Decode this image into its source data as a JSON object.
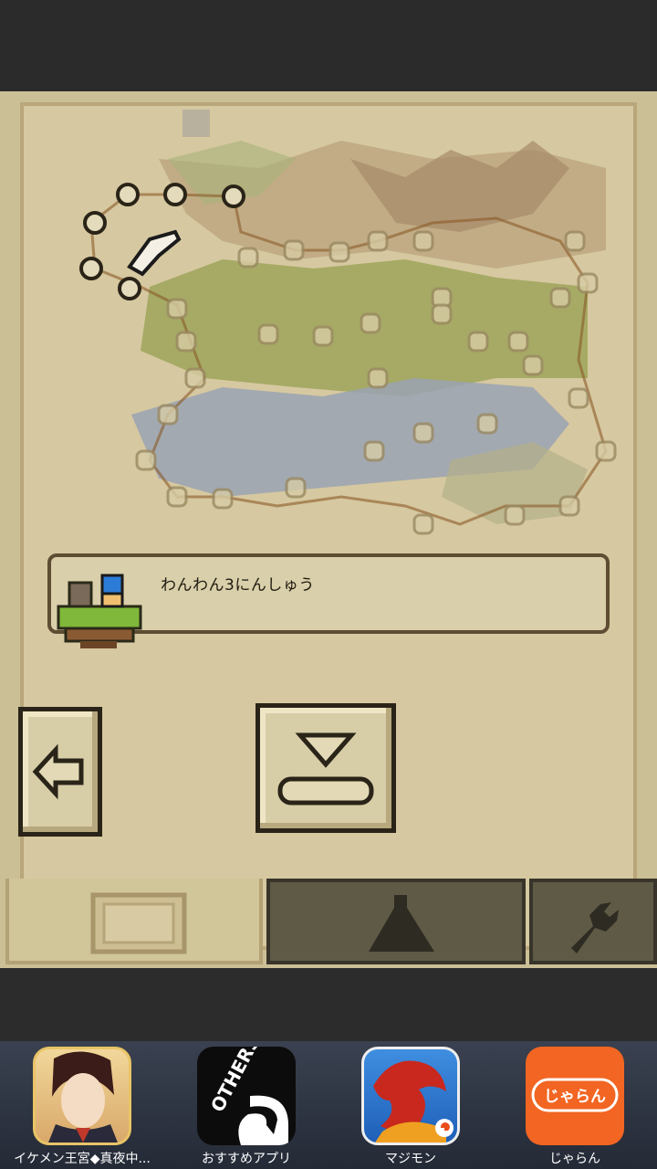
{
  "mission": {
    "text": "わんわん3にんしゅう"
  },
  "tabs": [
    {
      "id": "map",
      "icon": "map-scroll-icon",
      "selected": true
    },
    {
      "id": "camp",
      "icon": "tent-icon",
      "selected": false
    },
    {
      "id": "settings",
      "icon": "wrench-icon",
      "selected": false
    }
  ],
  "controls": {
    "back": {
      "icon": "left-arrow-icon"
    },
    "rest": {
      "icon": "rest-down-arrow-icon"
    }
  },
  "ads": [
    {
      "label": "イケメン王宮◆真夜中...",
      "icon": "ikemen-app-icon"
    },
    {
      "label": "おすすめアプリ",
      "icon": "others-app-icon",
      "icon_text": "OTHERS"
    },
    {
      "label": "マジモン",
      "icon": "majimon-app-icon"
    },
    {
      "label": "じゃらん",
      "icon": "jalan-app-icon",
      "icon_text": "じゃらん"
    }
  ]
}
